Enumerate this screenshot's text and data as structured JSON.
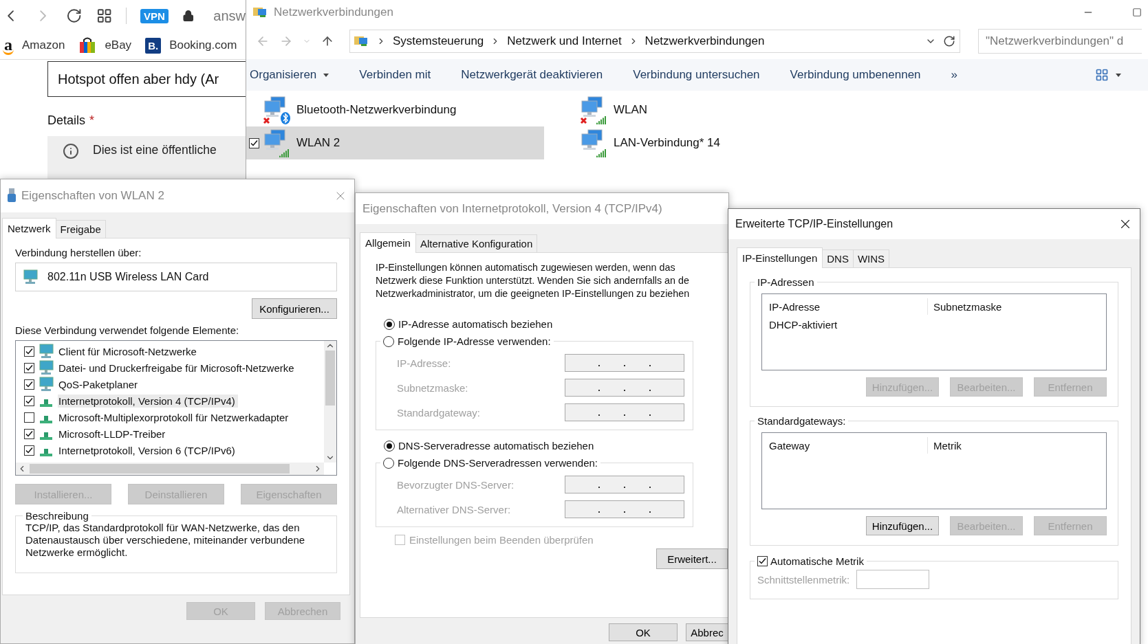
{
  "browser": {
    "vpn_badge": "VPN",
    "address": "answ",
    "bookmarks": [
      {
        "label": "Amazon",
        "icon_text": "a",
        "kind": "amazon"
      },
      {
        "label": "eBay",
        "kind": "bag"
      },
      {
        "label": "Booking.com",
        "icon_text": "B.",
        "kind": "square"
      }
    ],
    "title_field": {
      "value": "Hotspot offen aber hdy (Ar"
    },
    "details_label": "Details",
    "required_mark": "*",
    "notice": "Dies ist eine öffentliche"
  },
  "explorer": {
    "title": "Netzwerkverbindungen",
    "breadcrumb": [
      "Systemsteuerung",
      "Netzwerk und Internet",
      "Netzwerkverbindungen"
    ],
    "search": {
      "placeholder": "\"Netzwerkverbindungen\" d"
    },
    "commands": [
      {
        "label": "Organisieren",
        "kind": "dropdown"
      },
      {
        "label": "Verbinden mit",
        "kind": "plain"
      },
      {
        "label": "Netzwerkgerät deaktivieren",
        "kind": "plain"
      },
      {
        "label": "Verbindung untersuchen",
        "kind": "plain"
      },
      {
        "label": "Verbindung umbenennen",
        "kind": "plain"
      }
    ],
    "more_button": "»",
    "connections": [
      {
        "name": "Bluetooth-Netzwerkverbindung",
        "kind": "bluetooth",
        "disconnected": true,
        "selected": false
      },
      {
        "name": "WLAN",
        "kind": "wireless",
        "disconnected": true,
        "selected": false
      },
      {
        "name": "WLAN 2",
        "kind": "wireless",
        "disconnected": false,
        "selected": true
      },
      {
        "name": "LAN-Verbindung* 14",
        "kind": "wireless",
        "disconnected": false,
        "selected": false
      }
    ]
  },
  "wlan_dialog": {
    "title": "Eigenschaften von WLAN 2",
    "tabs": [
      {
        "label": "Netzwerk",
        "selected": true
      },
      {
        "label": "Freigabe",
        "selected": false
      }
    ],
    "connect_label": "Verbindung herstellen über:",
    "adapter": "802.11n USB Wireless LAN Card",
    "configure_button": "Konfigurieren...",
    "elements_label": "Diese Verbindung verwendet folgende Elemente:",
    "elements": [
      {
        "label": "Client für Microsoft-Netzwerke",
        "kind": "client",
        "checked": true,
        "selected": false
      },
      {
        "label": "Datei- und Druckerfreigabe für Microsoft-Netzwerke",
        "kind": "client",
        "checked": true,
        "selected": false
      },
      {
        "label": "QoS-Paketplaner",
        "kind": "client",
        "checked": true,
        "selected": false
      },
      {
        "label": "Internetprotokoll, Version 4 (TCP/IPv4)",
        "kind": "protocol",
        "checked": true,
        "selected": true
      },
      {
        "label": "Microsoft-Multiplexorprotokoll für Netzwerkadapter",
        "kind": "protocol",
        "checked": false,
        "selected": false
      },
      {
        "label": "Microsoft-LLDP-Treiber",
        "kind": "protocol",
        "checked": true,
        "selected": false
      },
      {
        "label": "Internetprotokoll, Version 6 (TCP/IPv6)",
        "kind": "protocol",
        "checked": true,
        "selected": false
      }
    ],
    "buttons": [
      {
        "label": "Installieren...",
        "disabled": true
      },
      {
        "label": "Deinstallieren",
        "disabled": true
      },
      {
        "label": "Eigenschaften",
        "disabled": true
      }
    ],
    "description_title": "Beschreibung",
    "description": "TCP/IP, das Standardprotokoll für WAN-Netzwerke, das den Datenaustausch über verschiedene, miteinander verbundene Netzwerke ermöglicht.",
    "footer_buttons": [
      {
        "label": "OK",
        "disabled": true
      },
      {
        "label": "Abbrechen",
        "disabled": true
      }
    ]
  },
  "ipv4_dialog": {
    "title": "Eigenschaften von Internetprotokoll, Version 4 (TCP/IPv4)",
    "tabs": [
      {
        "label": "Allgemein",
        "selected": true
      },
      {
        "label": "Alternative Konfiguration",
        "selected": false
      }
    ],
    "intro_lines": [
      "IP-Einstellungen können automatisch zugewiesen werden, wenn das",
      "Netzwerk diese Funktion unterstützt. Wenden Sie sich andernfalls an de",
      "Netzwerkadministrator, um die geeigneten IP-Einstellungen zu beziehen"
    ],
    "ip_options": [
      {
        "label": "IP-Adresse automatisch beziehen",
        "selected": true
      },
      {
        "label": "Folgende IP-Adresse verwenden:",
        "selected": false
      }
    ],
    "ip_fields": [
      {
        "label": "IP-Adresse:",
        "disabled": true
      },
      {
        "label": "Subnetzmaske:",
        "disabled": true
      },
      {
        "label": "Standardgateway:",
        "disabled": true
      }
    ],
    "dns_options": [
      {
        "label": "DNS-Serveradresse automatisch beziehen",
        "selected": true
      },
      {
        "label": "Folgende DNS-Serveradressen verwenden:",
        "selected": false
      }
    ],
    "dns_fields": [
      {
        "label": "Bevorzugter DNS-Server:",
        "disabled": true
      },
      {
        "label": "Alternativer DNS-Server:",
        "disabled": true
      }
    ],
    "validate": {
      "label": "Einstellungen beim Beenden überprüfen",
      "checked": false,
      "disabled": true
    },
    "advanced_button": "Erweitert...",
    "footer_buttons": [
      {
        "label": "OK",
        "disabled": false
      },
      {
        "label": "Abbrec",
        "disabled": false
      }
    ]
  },
  "tcp_dialog": {
    "title": "Erweiterte TCP/IP-Einstellungen",
    "tabs": [
      {
        "label": "IP-Einstellungen",
        "selected": true
      },
      {
        "label": "DNS",
        "selected": false
      },
      {
        "label": "WINS",
        "selected": false
      }
    ],
    "groups": [
      {
        "title": "IP-Adressen",
        "columns": [
          "IP-Adresse",
          "Subnetzmaske"
        ],
        "rows": [
          [
            "DHCP-aktiviert"
          ]
        ],
        "buttons": [
          {
            "label": "Hinzufügen...",
            "disabled": true
          },
          {
            "label": "Bearbeiten...",
            "disabled": true
          },
          {
            "label": "Entfernen",
            "disabled": true
          }
        ]
      },
      {
        "title": "Standardgateways:",
        "columns": [
          "Gateway",
          "Metrik"
        ],
        "buttons": [
          {
            "label": "Hinzufügen...",
            "disabled": false
          },
          {
            "label": "Bearbeiten...",
            "disabled": true
          },
          {
            "label": "Entfernen",
            "disabled": true
          }
        ]
      }
    ],
    "auto_metric": {
      "label": "Automatische Metrik",
      "checked": true
    },
    "interface_metric": {
      "label": "Schnittstellenmetrik:",
      "disabled": true
    }
  }
}
